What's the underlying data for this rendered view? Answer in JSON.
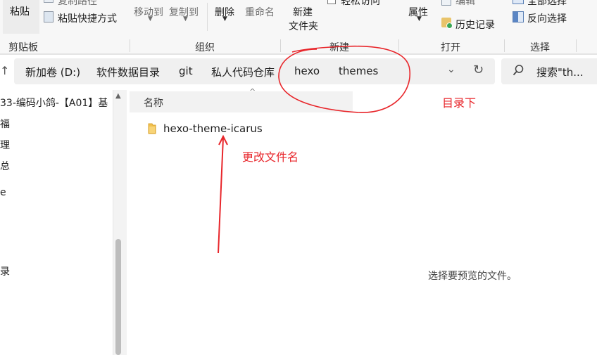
{
  "ribbon": {
    "clipboard": {
      "paste": "粘贴",
      "copy_path": "复制路径",
      "paste_shortcut": "粘贴快捷方式",
      "label": "剪贴板"
    },
    "organize": {
      "move_to": "移动到",
      "copy_to": "复制到",
      "delete": "删除",
      "rename": "重命名",
      "label": "组织"
    },
    "new": {
      "new_folder_line1": "新建",
      "new_folder_line2": "文件夹",
      "easy_access": "轻松访问",
      "label": "新建"
    },
    "open": {
      "properties": "属性",
      "edit": "编辑",
      "history": "历史记录",
      "label": "打开"
    },
    "select": {
      "select_all": "全部选择",
      "invert": "反向选择",
      "label": "选择"
    }
  },
  "breadcrumbs": [
    "新加卷 (D:)",
    "软件数据目录",
    "git",
    "私人代码仓库",
    "hexo",
    "themes"
  ],
  "search": {
    "placeholder": "搜索\"th..."
  },
  "nav": {
    "items": [
      "33-编码小鸽-【A01】基",
      "福",
      "理",
      "总",
      "e",
      "录"
    ]
  },
  "columns": {
    "name": "名称"
  },
  "files": [
    {
      "name": "hexo-theme-icarus",
      "icon": "folder-icon"
    }
  ],
  "preview": {
    "empty_text": "选择要预览的文件。"
  },
  "annotations": {
    "directory_note": "目录下",
    "rename_note": "更改文件名"
  },
  "colors": {
    "annotation": "#e8262b",
    "folder": "#f2c14e"
  }
}
